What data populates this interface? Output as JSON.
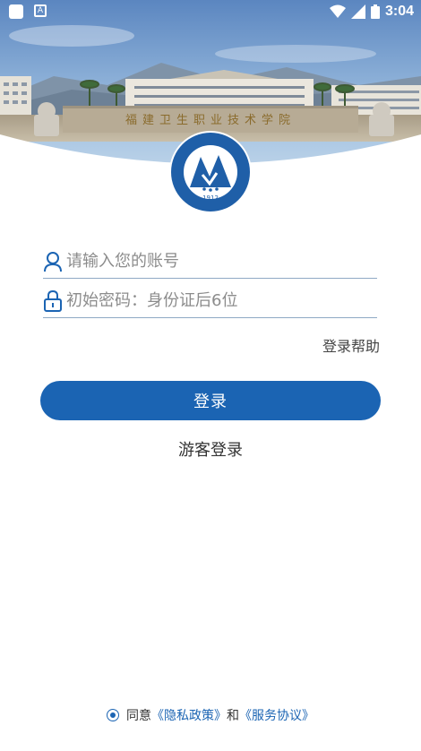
{
  "status_bar": {
    "time": "3:04"
  },
  "emblem": {
    "year": "1912",
    "ring_text_en": "FUJIAN HEALTH COLLEGE"
  },
  "form": {
    "account_placeholder": "请输入您的账号",
    "password_placeholder": "初始密码：身份证后6位",
    "help_label": "登录帮助"
  },
  "actions": {
    "login_label": "登录",
    "guest_label": "游客登录"
  },
  "agreement": {
    "prefix": "同意",
    "privacy_link": "《隐私政策》",
    "conjunction": "和",
    "service_link": "《服务协议》"
  },
  "colors": {
    "accent": "#1b64b3"
  }
}
